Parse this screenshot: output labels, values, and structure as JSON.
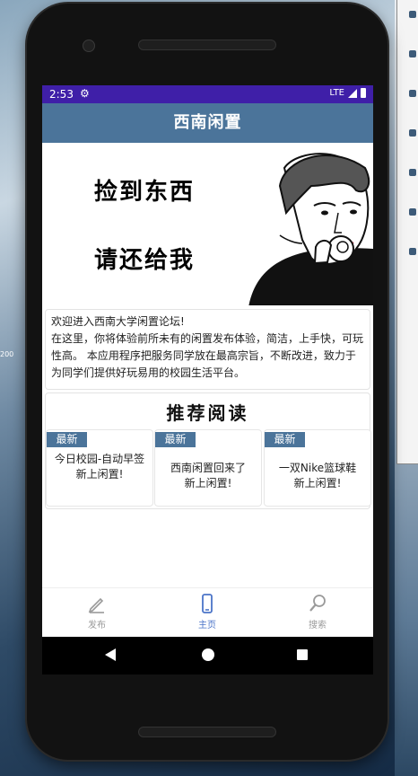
{
  "status_bar": {
    "time": "2:53",
    "network": "LTE"
  },
  "app": {
    "title": "西南闲置"
  },
  "banner": {
    "line1": "捡到东西",
    "line2": "请还给我"
  },
  "intro": {
    "line1": "欢迎进入西南大学闲置论坛!",
    "line2": "在这里，你将体验前所未有的闲置发布体验，简洁，上手快，可玩性高。 本应用程序把服务同学放在最高宗旨，不断改进，致力于为同学们提供好玩易用的校园生活平台。"
  },
  "recommended": {
    "title": "推荐阅读",
    "cards": [
      {
        "badge": "最新",
        "line1": "今日校园-自动早签",
        "line2": "新上闲置!"
      },
      {
        "badge": "最新",
        "line1": "西南闲置回来了",
        "line2": "新上闲置!"
      },
      {
        "badge": "最新",
        "line1": "一双Nike篮球鞋",
        "line2": "新上闲置!"
      }
    ]
  },
  "bottom_nav": [
    {
      "label": "发布",
      "icon": "edit-icon"
    },
    {
      "label": "主页",
      "icon": "phone-icon",
      "active": true
    },
    {
      "label": "搜索",
      "icon": "search-icon"
    }
  ],
  "desktop": {
    "edge_label": "200"
  },
  "colors": {
    "header": "#4b749a",
    "status_bar": "#3f1fa8",
    "active_nav": "#4b74c8"
  }
}
